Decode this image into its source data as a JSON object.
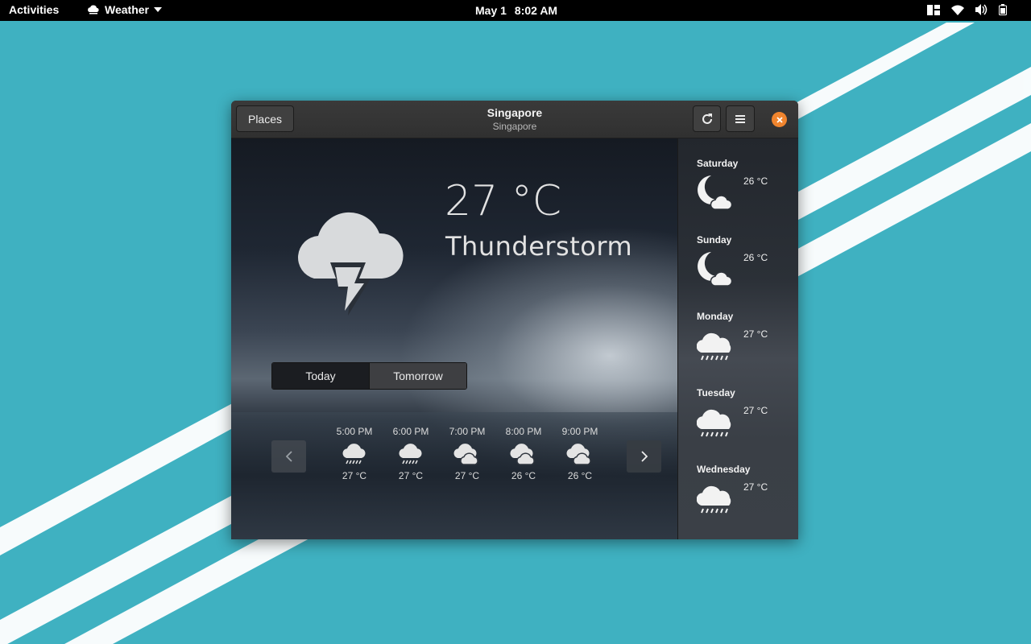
{
  "topbar": {
    "activities": "Activities",
    "app_name": "Weather",
    "date": "May 1",
    "time": "8:02 AM"
  },
  "window": {
    "places_label": "Places",
    "title": "Singapore",
    "subtitle": "Singapore"
  },
  "current": {
    "temperature": "27 °C",
    "condition": "Thunderstorm",
    "icon": "thunderstorm-icon"
  },
  "switcher": {
    "today": "Today",
    "tomorrow": "Tomorrow",
    "selected": "Today"
  },
  "hourly": [
    {
      "time": "5:00 PM",
      "temp": "27 °C",
      "icon": "rain-icon"
    },
    {
      "time": "6:00 PM",
      "temp": "27 °C",
      "icon": "rain-icon"
    },
    {
      "time": "7:00 PM",
      "temp": "27 °C",
      "icon": "cloudy-icon"
    },
    {
      "time": "8:00 PM",
      "temp": "26 °C",
      "icon": "cloudy-icon"
    },
    {
      "time": "9:00 PM",
      "temp": "26 °C",
      "icon": "cloudy-icon"
    }
  ],
  "daily": [
    {
      "day": "Saturday",
      "temp": "26 °C",
      "icon": "night-cloudy-icon"
    },
    {
      "day": "Sunday",
      "temp": "26 °C",
      "icon": "night-cloudy-icon"
    },
    {
      "day": "Monday",
      "temp": "27 °C",
      "icon": "rain-icon"
    },
    {
      "day": "Tuesday",
      "temp": "27 °C",
      "icon": "rain-icon"
    },
    {
      "day": "Wednesday",
      "temp": "27 °C",
      "icon": "rain-icon"
    }
  ],
  "colors": {
    "desktop": "#3fb1c1",
    "close_button": "#f0852e",
    "headerbar": "#353535"
  }
}
